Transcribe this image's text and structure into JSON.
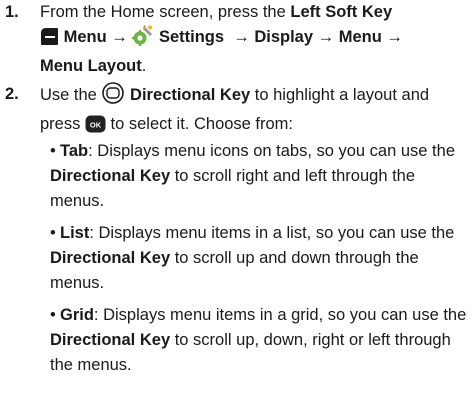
{
  "step1": {
    "number": "1.",
    "text_a": "From the Home screen, press the ",
    "left_soft_key": "Left Soft Key",
    "menu": "Menu",
    "arrow1": "→",
    "settings": "Settings",
    "arrow2": "→",
    "display": "Display",
    "arrow3": "→",
    "menu2": "Menu",
    "arrow4": "→",
    "menu_layout": "Menu Layout",
    "period": "."
  },
  "step2": {
    "number": "2.",
    "text_a": "Use the ",
    "directional_key": "Directional Key",
    "text_b": " to highlight a layout and press ",
    "ok_label": "OK",
    "text_c": " to select it. Choose from:"
  },
  "bullets": [
    {
      "marker": "•",
      "term": "Tab",
      "text_a": ": Displays menu icons on tabs, so you can use the ",
      "key": "Directional Key",
      "text_b": " to scroll right and left through the menus."
    },
    {
      "marker": "•",
      "term": "List",
      "text_a": ": Displays menu items in a list, so you can use the ",
      "key": "Directional Key",
      "text_b": " to scroll up and down through the menus."
    },
    {
      "marker": "•",
      "term": "Grid",
      "text_a": ": Displays menu items in a grid, so you can use the ",
      "key": "Directional Key",
      "text_b": " to scroll up, down, right or left through the menus."
    }
  ]
}
